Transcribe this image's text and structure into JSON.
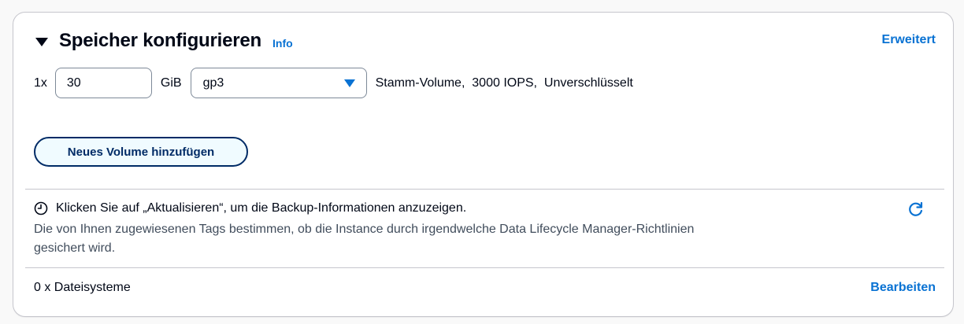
{
  "header": {
    "title": "Speicher konfigurieren",
    "info_link": "Info",
    "advanced_link": "Erweitert"
  },
  "storage": {
    "quantity_prefix": "1x",
    "size_value": "30",
    "unit": "GiB",
    "volume_type": "gp3",
    "volume_description": "Stamm-Volume,  3000 IOPS,  Unverschlüsselt"
  },
  "add_volume_button": "Neues Volume hinzufügen",
  "backup": {
    "message": "Klicken Sie auf „Aktualisieren“, um die Backup-Informationen anzuzeigen.",
    "description": "Die von Ihnen zugewiesenen Tags bestimmen, ob die Instance durch irgendwelche Data Lifecycle Manager-Richtlinien gesichert wird."
  },
  "file_systems": {
    "label": "0 x Dateisysteme",
    "edit_link": "Bearbeiten"
  },
  "colors": {
    "link": "#0972d3",
    "button_border": "#002b66",
    "button_bg": "#f0fbff",
    "border": "#c6c6cd"
  },
  "icons": [
    "caret-down-icon",
    "dropdown-arrow-icon",
    "clock-icon",
    "refresh-icon"
  ]
}
